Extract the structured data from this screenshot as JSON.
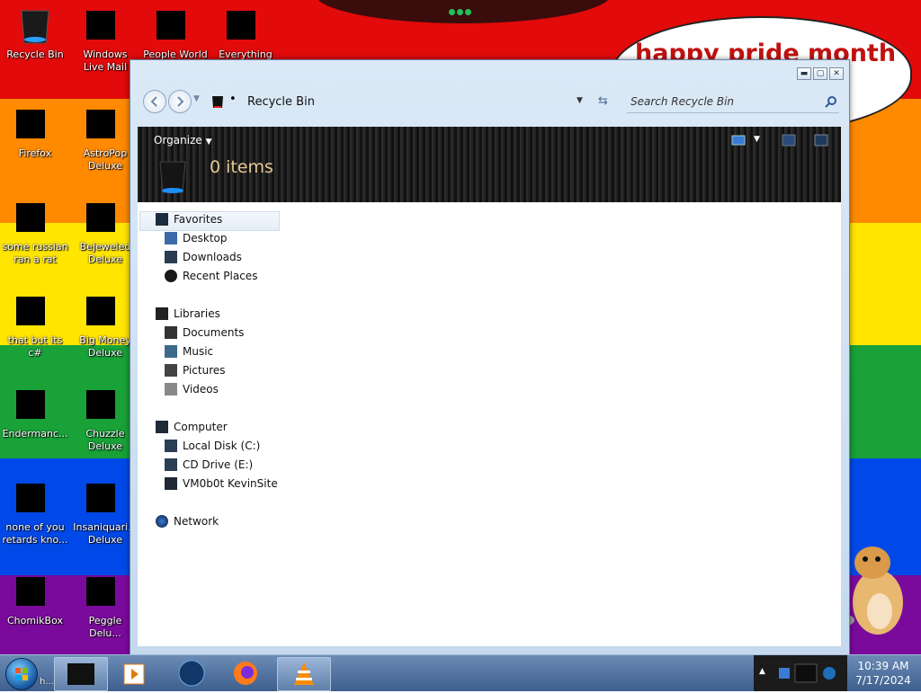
{
  "colors": {
    "stripes": [
      "#e20a0a",
      "#ff8a00",
      "#ffe500",
      "#18a238",
      "#0049e8",
      "#7a0a9c"
    ],
    "accent": "#3a7bd5",
    "bubble_text": "#c11111"
  },
  "bubble": {
    "text": "happy pride month"
  },
  "desktop_icons": [
    {
      "label": "Recycle Bin",
      "icon": "recycle-bin-icon"
    },
    {
      "label": "Windows Live Mail",
      "icon": "mail-icon"
    },
    {
      "label": "People World",
      "icon": "people-icon"
    },
    {
      "label": "Everything",
      "icon": "search-icon"
    },
    {
      "label": "Firefox",
      "icon": "firefox-icon"
    },
    {
      "label": "AstroPop Deluxe",
      "icon": "game-icon"
    },
    {
      "label": "some russian ran a rat",
      "icon": "ie-icon"
    },
    {
      "label": "Bejeweled Deluxe",
      "icon": "gem-icon"
    },
    {
      "label": "that but its c#",
      "icon": "window-icon"
    },
    {
      "label": "Big Money Deluxe",
      "icon": "money-bag-icon"
    },
    {
      "label": "Endermanc...",
      "icon": "terminal-icon"
    },
    {
      "label": "Chuzzle Deluxe",
      "icon": "chuzzle-icon"
    },
    {
      "label": "none of you retards kno...",
      "icon": "opera-icon"
    },
    {
      "label": "Insaniquari... Deluxe",
      "icon": "fish-icon"
    },
    {
      "label": "ChomikBox",
      "icon": "hamster-box-icon"
    },
    {
      "label": "Peggle Delu...",
      "icon": "peggle-icon"
    }
  ],
  "window": {
    "address": "Recycle Bin",
    "search_placeholder": "Search Recycle Bin",
    "organize": "Organize",
    "items_count": "0 items",
    "caption": {
      "min": "▬",
      "max": "▢",
      "close": "✕"
    }
  },
  "nav": {
    "favorites": "Favorites",
    "favorites_items": [
      "Desktop",
      "Downloads",
      "Recent Places"
    ],
    "libraries": "Libraries",
    "libraries_items": [
      "Documents",
      "Music",
      "Pictures",
      "Videos"
    ],
    "computer": "Computer",
    "computer_items": [
      "Local Disk (C:)",
      "CD Drive (E:)",
      "VM0b0t KevinSite"
    ],
    "network": "Network"
  },
  "taskbar": {
    "start_label": "h... ww",
    "buttons": [
      "explorer",
      "media-player",
      "globe",
      "firefox",
      "vlc"
    ],
    "clock_time": "10:39 AM",
    "clock_date": "7/17/2024"
  }
}
